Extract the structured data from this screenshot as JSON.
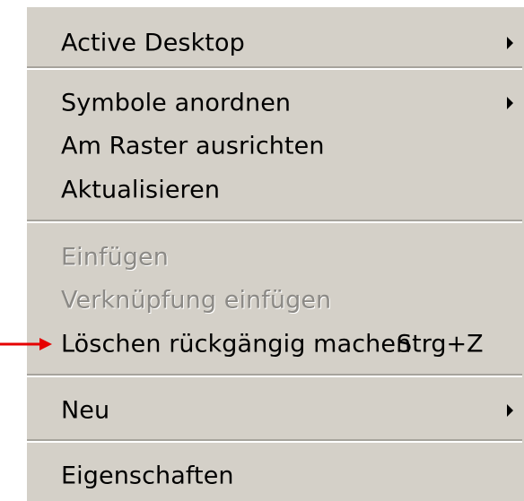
{
  "context_menu": {
    "items": [
      {
        "label": "Active Desktop",
        "submenu": true
      },
      {
        "label": "Symbole anordnen",
        "submenu": true
      },
      {
        "label": "Am Raster ausrichten"
      },
      {
        "label": "Aktualisieren"
      },
      {
        "label": "Einfügen",
        "disabled": true
      },
      {
        "label": "Verknüpfung einfügen",
        "disabled": true
      },
      {
        "label": "Löschen rückgängig machen",
        "shortcut": "Strg+Z"
      },
      {
        "label": "Neu",
        "submenu": true
      },
      {
        "label": "Eigenschaften"
      }
    ]
  },
  "colors": {
    "menu_bg": "#d4d0c8",
    "disabled_text": "#8c8a86",
    "pointer_arrow": "#e60000"
  },
  "icons": {
    "submenu": "submenu-arrow-icon",
    "pointer": "red-arrow-pointer-icon"
  }
}
